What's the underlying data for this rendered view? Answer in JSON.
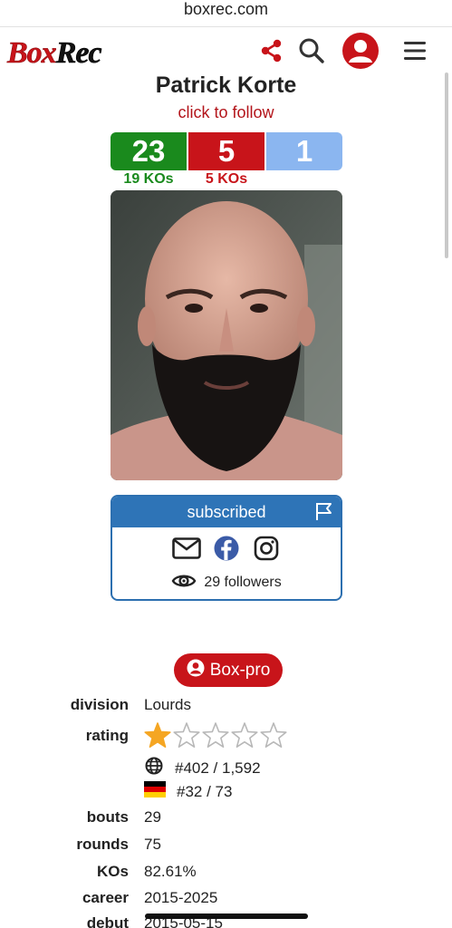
{
  "browser": {
    "url": "boxrec.com"
  },
  "header": {
    "logo_part1": "Box",
    "logo_part2": "Rec",
    "icons": [
      "share-icon",
      "search-icon",
      "user-icon",
      "menu-icon"
    ]
  },
  "boxer": {
    "name": "Patrick Korte",
    "follow_link": "click to follow",
    "record": {
      "wins": "23",
      "losses": "5",
      "draws": "1"
    },
    "kos": {
      "wins_kos": "19 KOs",
      "losses_kos": "5 KOs"
    }
  },
  "subscription": {
    "status": "subscribed",
    "followers": "29 followers",
    "icons": [
      "flag-icon",
      "email-icon",
      "facebook-icon",
      "instagram-icon",
      "eye-icon"
    ]
  },
  "profile_button": {
    "label": "Box-pro",
    "icon": "user-circle-icon"
  },
  "stats": {
    "division": {
      "label": "division",
      "value": "Lourds"
    },
    "rating": {
      "label": "rating",
      "stars_filled": 1,
      "stars_total": 5
    },
    "world_rank": "#402 / 1,592",
    "country_rank": "#32 / 73",
    "bouts": {
      "label": "bouts",
      "value": "29"
    },
    "rounds": {
      "label": "rounds",
      "value": "75"
    },
    "kos": {
      "label": "KOs",
      "value": "82.61%"
    },
    "career": {
      "label": "career",
      "value": "2015-2025"
    },
    "debut": {
      "label": "debut",
      "value": "2015-05-15"
    }
  },
  "colors": {
    "brand_red": "#c8141a",
    "win_green": "#1a8a1d",
    "draw_blue": "#8bb6f0",
    "subscribe_blue": "#2e74b7",
    "star_gold": "#f5a623"
  }
}
